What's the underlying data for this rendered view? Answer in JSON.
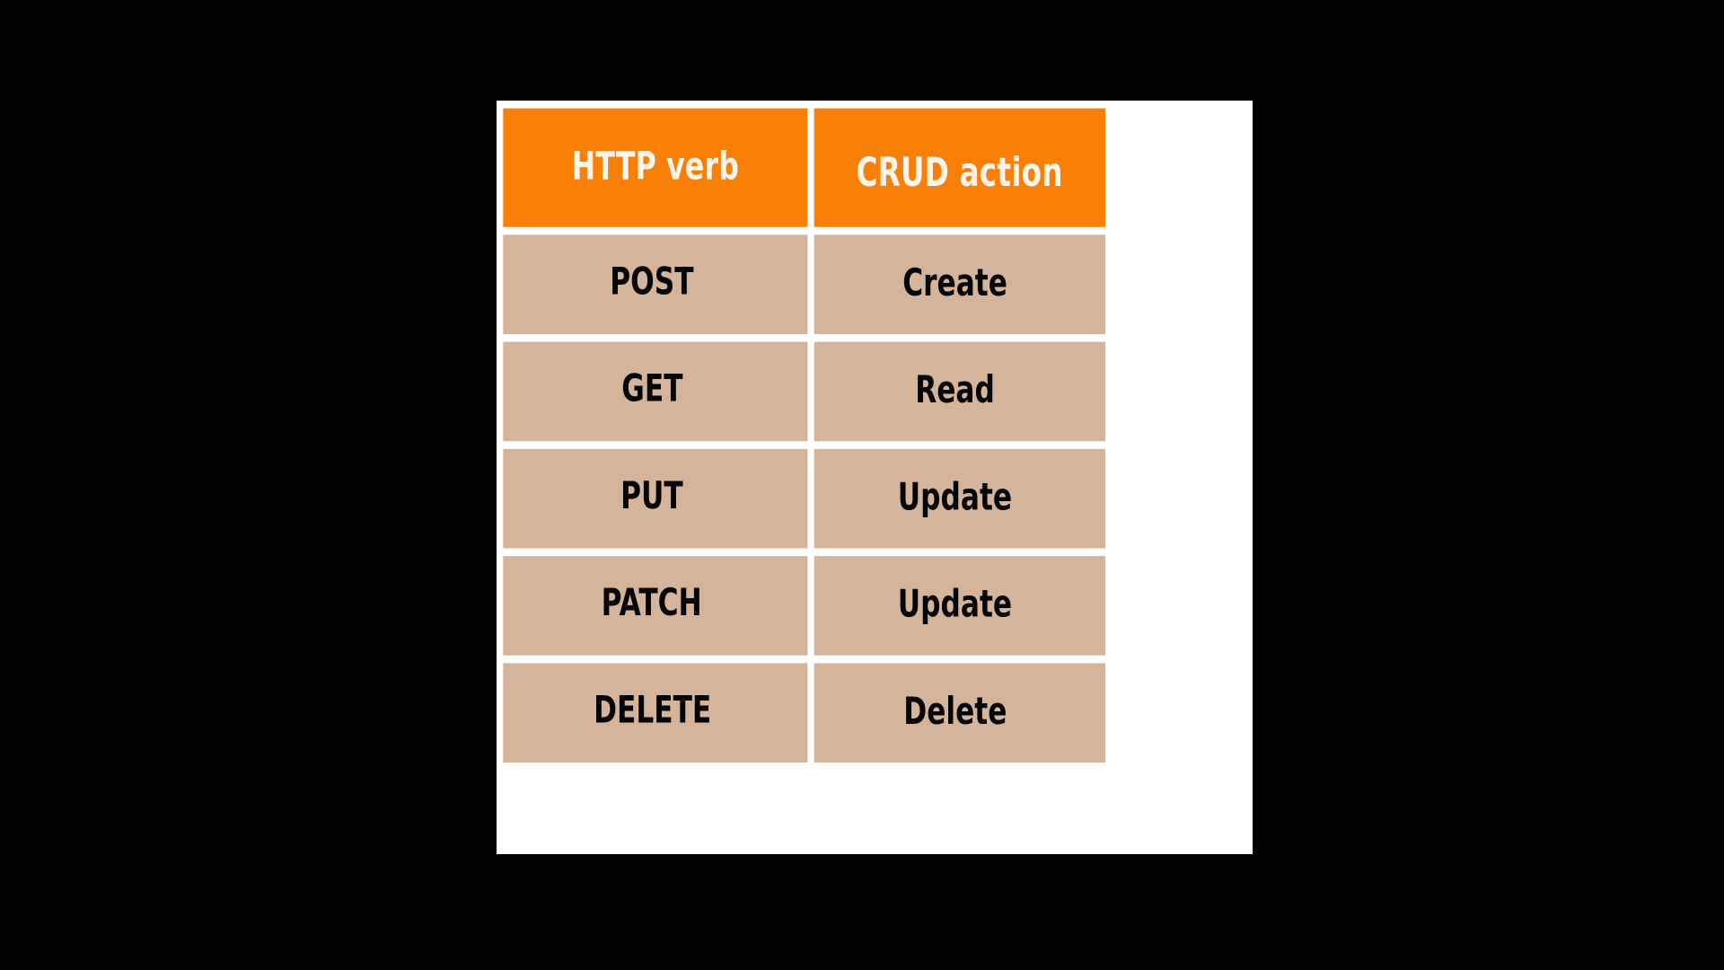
{
  "background_color": "#000000",
  "table": {
    "border_color": "#FFFFFF",
    "header_background": "#F98007",
    "header_text_color": "#FDF5EC",
    "cell_background": "#D4B59C",
    "cell_text_color": "#050505",
    "columns": [
      {
        "key": "http_verb",
        "header": "HTTP verb"
      },
      {
        "key": "crud_action",
        "header": "CRUD action"
      }
    ],
    "rows": [
      {
        "http_verb": "POST",
        "crud_action": "Create"
      },
      {
        "http_verb": "GET",
        "crud_action": "Read"
      },
      {
        "http_verb": "PUT",
        "crud_action": "Update"
      },
      {
        "http_verb": "PATCH",
        "crud_action": "Update"
      },
      {
        "http_verb": "DELETE",
        "crud_action": "Delete"
      }
    ]
  },
  "chart_data": {
    "type": "table",
    "title": "",
    "columns": [
      "HTTP verb",
      "CRUD action"
    ],
    "rows": [
      [
        "POST",
        "Create"
      ],
      [
        "GET",
        "Read"
      ],
      [
        "PUT",
        "Update"
      ],
      [
        "PATCH",
        "Update"
      ],
      [
        "DELETE",
        "Delete"
      ]
    ]
  }
}
